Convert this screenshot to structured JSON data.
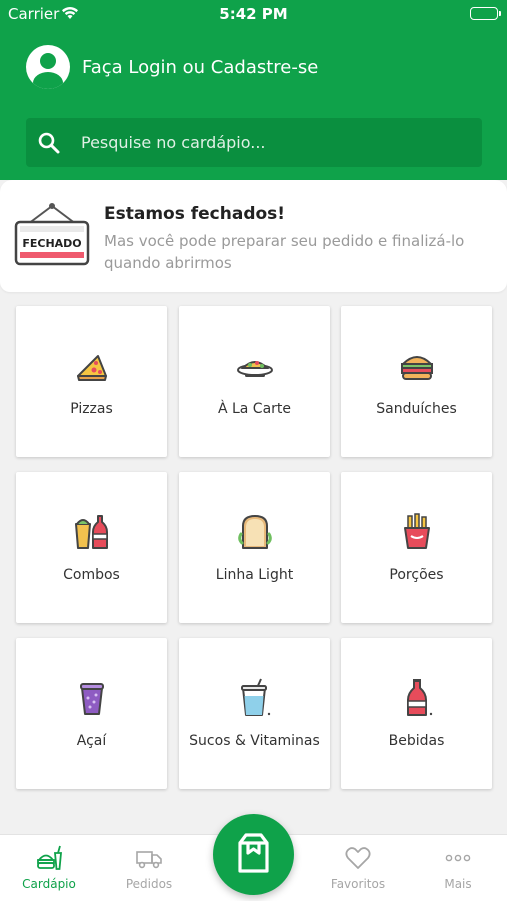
{
  "status_bar": {
    "carrier": "Carrier",
    "time": "5:42 PM"
  },
  "header": {
    "login_text": "Faça Login ou Cadastre-se",
    "search_placeholder": "Pesquise no cardápio..."
  },
  "closed_notice": {
    "sign_text": "FECHADO",
    "title": "Estamos fechados!",
    "subtitle": "Mas você pode preparar seu pedido e finalizá-lo quando abrirmos"
  },
  "categories": [
    {
      "label": "Pizzas",
      "icon": "pizza-icon"
    },
    {
      "label": "À La Carte",
      "icon": "plate-icon"
    },
    {
      "label": "Sanduíches",
      "icon": "burger-icon"
    },
    {
      "label": "Combos",
      "icon": "combo-icon"
    },
    {
      "label": "Linha Light",
      "icon": "sandwich-icon"
    },
    {
      "label": "Porções",
      "icon": "fries-icon"
    },
    {
      "label": "Açaí",
      "icon": "acai-cup-icon"
    },
    {
      "label": "Sucos & Vitaminas",
      "icon": "juice-cup-icon"
    },
    {
      "label": "Bebidas",
      "icon": "soda-bottle-icon"
    }
  ],
  "tabs": [
    {
      "label": "Cardápio",
      "icon": "menu-food-icon",
      "active": true
    },
    {
      "label": "Pedidos",
      "icon": "delivery-truck-icon",
      "active": false
    },
    {
      "label": "Favoritos",
      "icon": "heart-icon",
      "active": false
    },
    {
      "label": "Mais",
      "icon": "more-dots-icon",
      "active": false
    }
  ],
  "cart_button": {
    "icon": "shopping-bag-icon"
  },
  "colors": {
    "brand_green": "#0fa24a",
    "search_bg": "#0a8f3f",
    "background": "#f1f1f1",
    "inactive_tab": "#a6a6a6"
  }
}
